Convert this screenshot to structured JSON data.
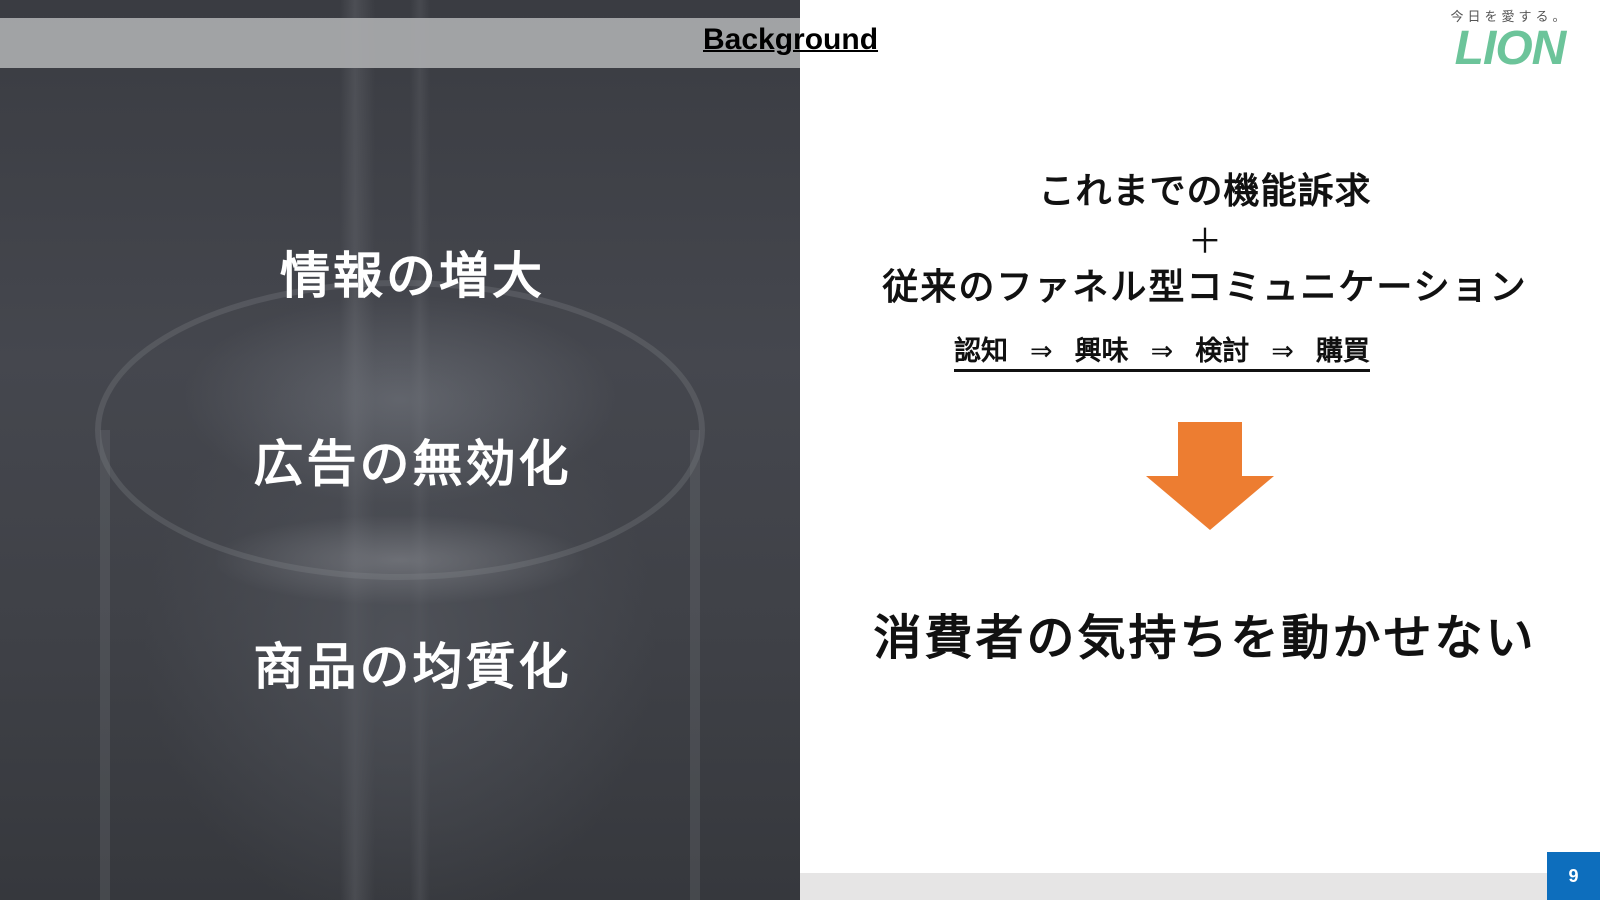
{
  "slide": {
    "title": "Background",
    "page_number": "9"
  },
  "logo": {
    "tagline": "今日を愛する。",
    "wordmark": "LION",
    "color": "#6cc49a"
  },
  "left_panel": {
    "items": [
      "情報の増大",
      "広告の無効化",
      "商品の均質化"
    ]
  },
  "right_panel": {
    "line1": "これまでの機能訴求",
    "plus": "＋",
    "line2": "従来のファネル型コミュニケーション",
    "funnel_steps": [
      "認知",
      "興味",
      "検討",
      "購買"
    ],
    "funnel_arrow": "⇒",
    "arrow_color": "#ed7d31",
    "conclusion": "消費者の気持ちを動かせない"
  },
  "colors": {
    "page_badge": "#0d6ebd",
    "footer_bar": "#e6e5e5"
  }
}
